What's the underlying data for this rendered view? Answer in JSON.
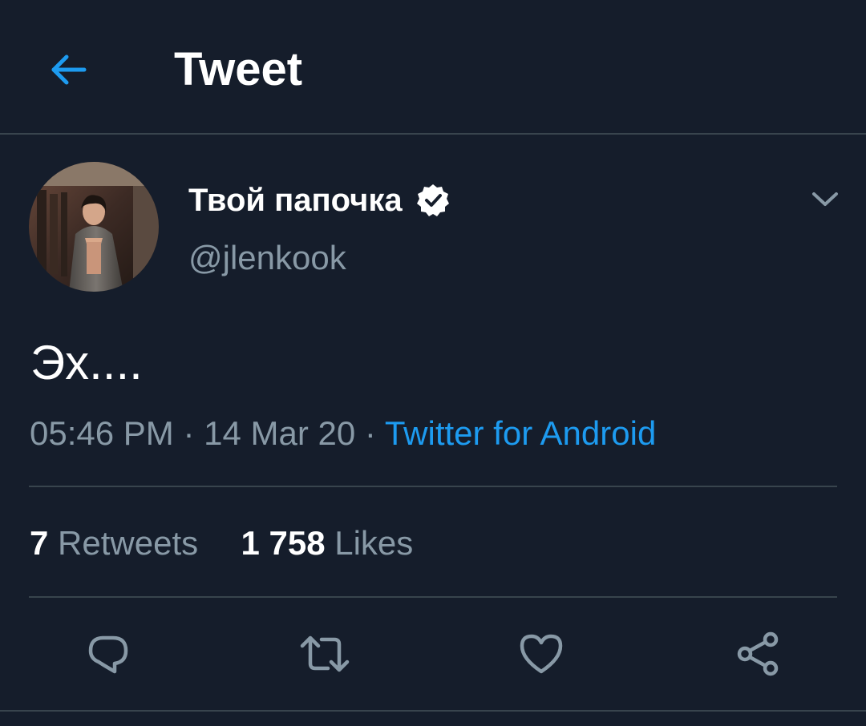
{
  "header": {
    "title": "Tweet",
    "back_icon": "arrow-left-icon",
    "accent_color": "#1d9bf0"
  },
  "tweet": {
    "author": {
      "display_name": "Твой папочка",
      "handle": "@jlenkook",
      "verified": true,
      "verified_icon": "verified-badge-icon"
    },
    "text": "Эх....",
    "time": "05:46 PM",
    "separator": "·",
    "date": "14 Mar 20",
    "source": "Twitter for Android",
    "menu_icon": "chevron-down-icon"
  },
  "stats": {
    "retweets_count": "7",
    "retweets_label": "Retweets",
    "likes_count": "1 758",
    "likes_label": "Likes"
  },
  "actions": [
    {
      "name": "reply",
      "icon": "reply-icon"
    },
    {
      "name": "retweet",
      "icon": "retweet-icon"
    },
    {
      "name": "like",
      "icon": "heart-icon"
    },
    {
      "name": "share",
      "icon": "share-icon"
    }
  ],
  "colors": {
    "background": "#151d2b",
    "text_primary": "#ffffff",
    "text_secondary": "#8899a6",
    "divider": "#38444d",
    "link": "#1d9bf0"
  }
}
